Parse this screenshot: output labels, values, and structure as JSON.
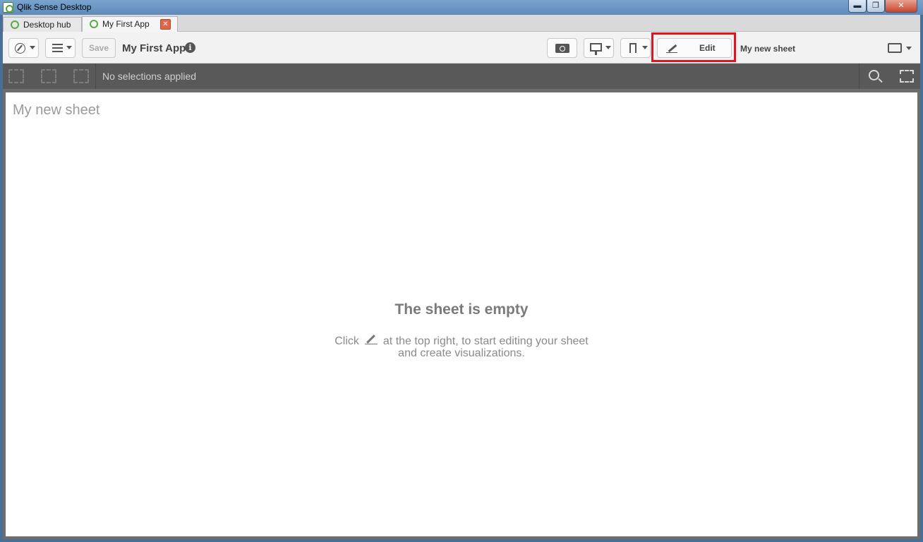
{
  "window": {
    "title": "Qlik Sense Desktop",
    "controls": {
      "minimize": "▬",
      "maximize": "❐",
      "close": "✕"
    }
  },
  "tabs": [
    {
      "label": "Desktop hub",
      "icon": "qlik-icon"
    },
    {
      "label": "My First App",
      "icon": "qlik-icon",
      "close": "✕"
    }
  ],
  "toolbar": {
    "save_label": "Save",
    "app_title": "My First App",
    "info_glyph": "i",
    "edit_label": "Edit",
    "current_sheet": "My new sheet",
    "highlight_color": "#e0141c"
  },
  "selections": {
    "status_text": "No selections applied"
  },
  "sheet": {
    "title": "My new sheet",
    "empty_title": "The sheet is empty",
    "empty_line1_pre": "Click",
    "empty_line1_post": "at the top right, to start editing your sheet",
    "empty_line2": "and create visualizations."
  }
}
